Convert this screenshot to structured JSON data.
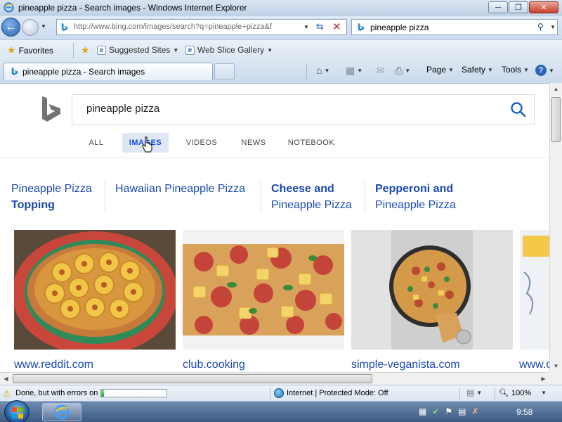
{
  "window": {
    "title": "pineapple pizza - Search images - Windows Internet Explorer"
  },
  "nav": {
    "address": "http://www.bing.com/images/search?q=pineapple+pizza&f",
    "search_query": "pineapple pizza"
  },
  "favorites_bar": {
    "favorites_label": "Favorites",
    "links": [
      {
        "label": "Suggested Sites"
      },
      {
        "label": "Web Slice Gallery"
      }
    ]
  },
  "tab": {
    "title": "pineapple pizza - Search images"
  },
  "command_bar": {
    "page": "Page",
    "safety": "Safety",
    "tools": "Tools"
  },
  "bing": {
    "query": "pineapple pizza",
    "scopes": [
      {
        "label": "ALL",
        "active": false
      },
      {
        "label": "IMAGES",
        "active": true
      },
      {
        "label": "VIDEOS",
        "active": false
      },
      {
        "label": "NEWS",
        "active": false
      },
      {
        "label": "NOTEBOOK",
        "active": false
      }
    ],
    "related": [
      {
        "plain": "Pineapple Pizza",
        "bold": "Topping"
      },
      {
        "plain": "Hawaiian Pineapple Pizza",
        "bold": ""
      },
      {
        "bold": "Cheese and",
        "plain": "Pineapple Pizza"
      },
      {
        "bold": "Pepperoni and",
        "plain": "Pineapple Pizza"
      }
    ],
    "results": [
      {
        "source": "www.reddit.com"
      },
      {
        "source": "club.cooking"
      },
      {
        "source": "simple-veganista.com"
      },
      {
        "source": "www.c"
      }
    ]
  },
  "status": {
    "text": "Done, but with errors on page.",
    "progress": 0.04,
    "zone": "Internet | Protected Mode: Off",
    "zoom": "100%"
  },
  "taskbar": {
    "clock": "9:58"
  },
  "colors": {
    "link": "#1a48b2",
    "accent": "#174ae4"
  }
}
